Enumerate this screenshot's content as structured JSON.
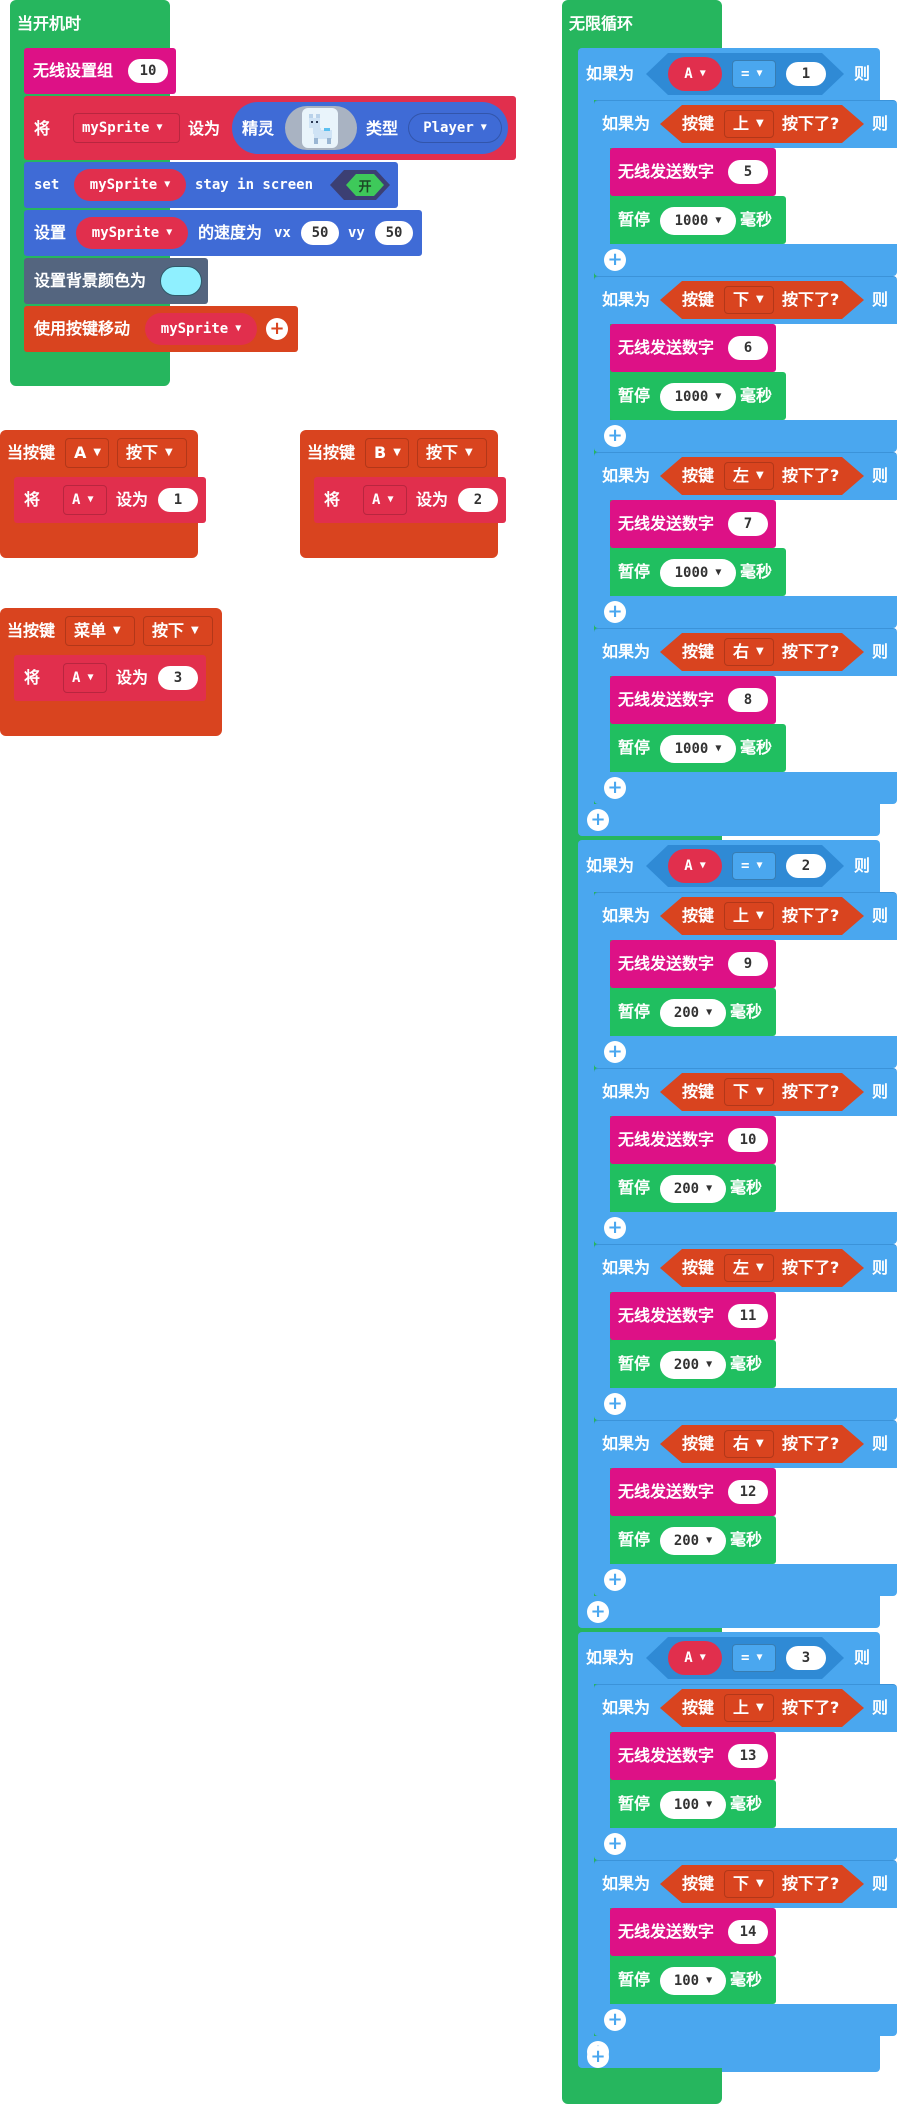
{
  "colors": {
    "green": "#26b65e",
    "loop_blue": "#4aa7ef",
    "sprite_blue": "#3f6bd6",
    "red": "#e12f4d",
    "magenta": "#dd1186",
    "orange": "#d9441f",
    "slate": "#54657f",
    "toggle": "#3ec95a",
    "bg_swatch": "#8ff0ff"
  },
  "on_start": {
    "title": "当开机时",
    "radio_group": {
      "label": "无线设置组",
      "value": "10"
    },
    "set_sprite": {
      "prefix": "将",
      "var": "mySprite",
      "set": "设为",
      "sprite_label": "精灵",
      "type_label": "类型",
      "type_value": "Player",
      "image_icon": "llama-sprite-icon"
    },
    "stay": {
      "set": "set",
      "var": "mySprite",
      "text": "stay in screen",
      "toggle": "开"
    },
    "velocity": {
      "prefix": "设置",
      "var": "mySprite",
      "text": "的速度为",
      "vx_label": "vx",
      "vx": "50",
      "vy_label": "vy",
      "vy": "50"
    },
    "bg_color": {
      "label": "设置背景颜色为"
    },
    "move": {
      "label": "使用按键移动",
      "var": "mySprite"
    }
  },
  "events": [
    {
      "when": "当按键",
      "button": "A",
      "action": "按下",
      "set": "将",
      "var": "A",
      "set_to": "设为",
      "value": "1"
    },
    {
      "when": "当按键",
      "button": "B",
      "action": "按下",
      "set": "将",
      "var": "A",
      "set_to": "设为",
      "value": "2"
    },
    {
      "when": "当按键",
      "button": "菜单",
      "action": "按下",
      "set": "将",
      "var": "A",
      "set_to": "设为",
      "value": "3"
    }
  ],
  "forever": {
    "title": "无限循环",
    "labels": {
      "if": "如果为",
      "then": "则",
      "button": "按键",
      "pressed": "按下了?",
      "send": "无线发送数字",
      "pause": "暂停",
      "ms": "毫秒",
      "op": "=",
      "var": "A"
    },
    "groups": [
      {
        "value": "1",
        "items": [
          {
            "dir": "上",
            "num": "5",
            "pause": "1000"
          },
          {
            "dir": "下",
            "num": "6",
            "pause": "1000"
          },
          {
            "dir": "左",
            "num": "7",
            "pause": "1000"
          },
          {
            "dir": "右",
            "num": "8",
            "pause": "1000"
          }
        ]
      },
      {
        "value": "2",
        "items": [
          {
            "dir": "上",
            "num": "9",
            "pause": "200"
          },
          {
            "dir": "下",
            "num": "10",
            "pause": "200"
          },
          {
            "dir": "左",
            "num": "11",
            "pause": "200"
          },
          {
            "dir": "右",
            "num": "12",
            "pause": "200"
          }
        ]
      },
      {
        "value": "3",
        "items": [
          {
            "dir": "上",
            "num": "13",
            "pause": "100"
          },
          {
            "dir": "下",
            "num": "14",
            "pause": "100"
          }
        ]
      }
    ]
  }
}
